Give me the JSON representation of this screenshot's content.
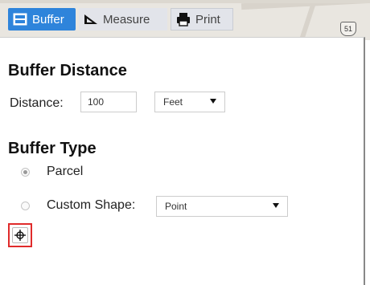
{
  "toolbar": {
    "tabs": [
      {
        "label": "Buffer",
        "icon": "buffer-icon",
        "active": true
      },
      {
        "label": "Measure",
        "icon": "measure-icon",
        "active": false
      },
      {
        "label": "Print",
        "icon": "print-icon",
        "active": false
      }
    ]
  },
  "map": {
    "shield_label": "51"
  },
  "buffer_distance": {
    "heading": "Buffer Distance",
    "distance_label": "Distance:",
    "distance_value": "100",
    "unit_selected": "Feet"
  },
  "buffer_type": {
    "heading": "Buffer Type",
    "options": [
      {
        "label": "Parcel",
        "checked": true
      },
      {
        "label": "Custom Shape:",
        "checked": false
      }
    ],
    "shape_selected": "Point"
  },
  "draw_tool": {
    "icon": "crosshair-icon"
  },
  "colors": {
    "active_tab": "#2e84db",
    "highlight_border": "#e02b2b"
  }
}
